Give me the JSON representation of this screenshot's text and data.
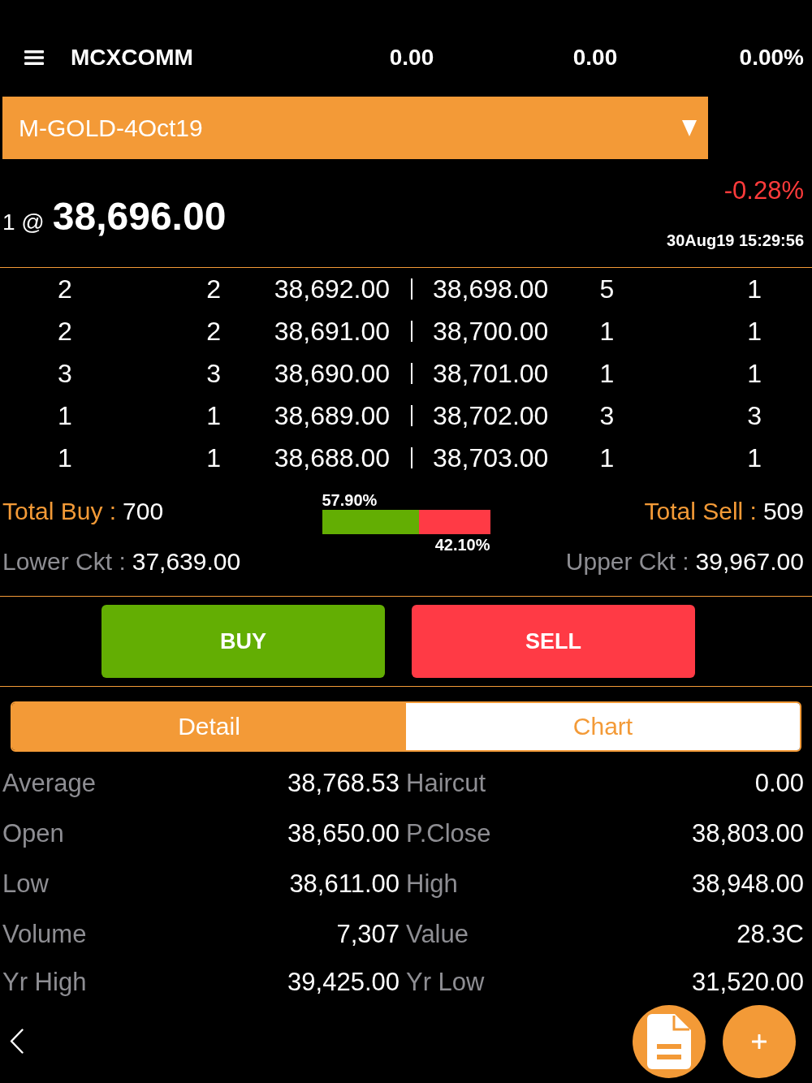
{
  "header": {
    "title": "MCXCOMM",
    "values": [
      "0.00",
      "0.00",
      "0.00%"
    ]
  },
  "symbol_dropdown": {
    "value": "M-GOLD-4Oct19"
  },
  "quote": {
    "quantity_at": "1 @",
    "price": "38,696.00",
    "change": "-0.28%",
    "negative": true,
    "timestamp": "30Aug19 15:29:56"
  },
  "market_depth": {
    "rows": [
      [
        "2",
        "2",
        "38,692.00",
        "38,698.00",
        "5",
        "1"
      ],
      [
        "2",
        "2",
        "38,691.00",
        "38,700.00",
        "1",
        "1"
      ],
      [
        "3",
        "3",
        "38,690.00",
        "38,701.00",
        "1",
        "1"
      ],
      [
        "1",
        "1",
        "38,689.00",
        "38,702.00",
        "3",
        "3"
      ],
      [
        "1",
        "1",
        "38,688.00",
        "38,703.00",
        "1",
        "1"
      ]
    ]
  },
  "totals": {
    "buy_label": "Total Buy :",
    "buy_value": "700",
    "sell_label": "Total Sell :",
    "sell_value": "509",
    "lower_label": "Lower Ckt :",
    "lower_value": "37,639.00",
    "upper_label": "Upper Ckt :",
    "upper_value": "39,967.00",
    "bar": {
      "level": 0.579,
      "buy_label": "57.90%",
      "sell_label": "42.10%"
    }
  },
  "actions": [
    {
      "kind": "buy",
      "label": "BUY"
    },
    {
      "kind": "sell",
      "label": "SELL"
    }
  ],
  "tabs": [
    {
      "label": "Detail",
      "selected": true
    },
    {
      "label": "Chart",
      "selected": false
    }
  ],
  "details": {
    "rows": [
      [
        {
          "label": "Average",
          "value": "38,768.53"
        },
        {
          "label": "Haircut",
          "value": "0.00"
        }
      ],
      [
        {
          "label": "Open",
          "value": "38,650.00"
        },
        {
          "label": "P.Close",
          "value": "38,803.00"
        }
      ],
      [
        {
          "label": "Low",
          "value": "38,611.00"
        },
        {
          "label": "High",
          "value": "38,948.00"
        }
      ],
      [
        {
          "label": "Volume",
          "value": "7,307"
        },
        {
          "label": "Value",
          "value": "28.3C"
        }
      ],
      [
        {
          "label": "Yr High",
          "value": "39,425.00"
        },
        {
          "label": "Yr Low",
          "value": "31,520.00"
        }
      ]
    ]
  }
}
